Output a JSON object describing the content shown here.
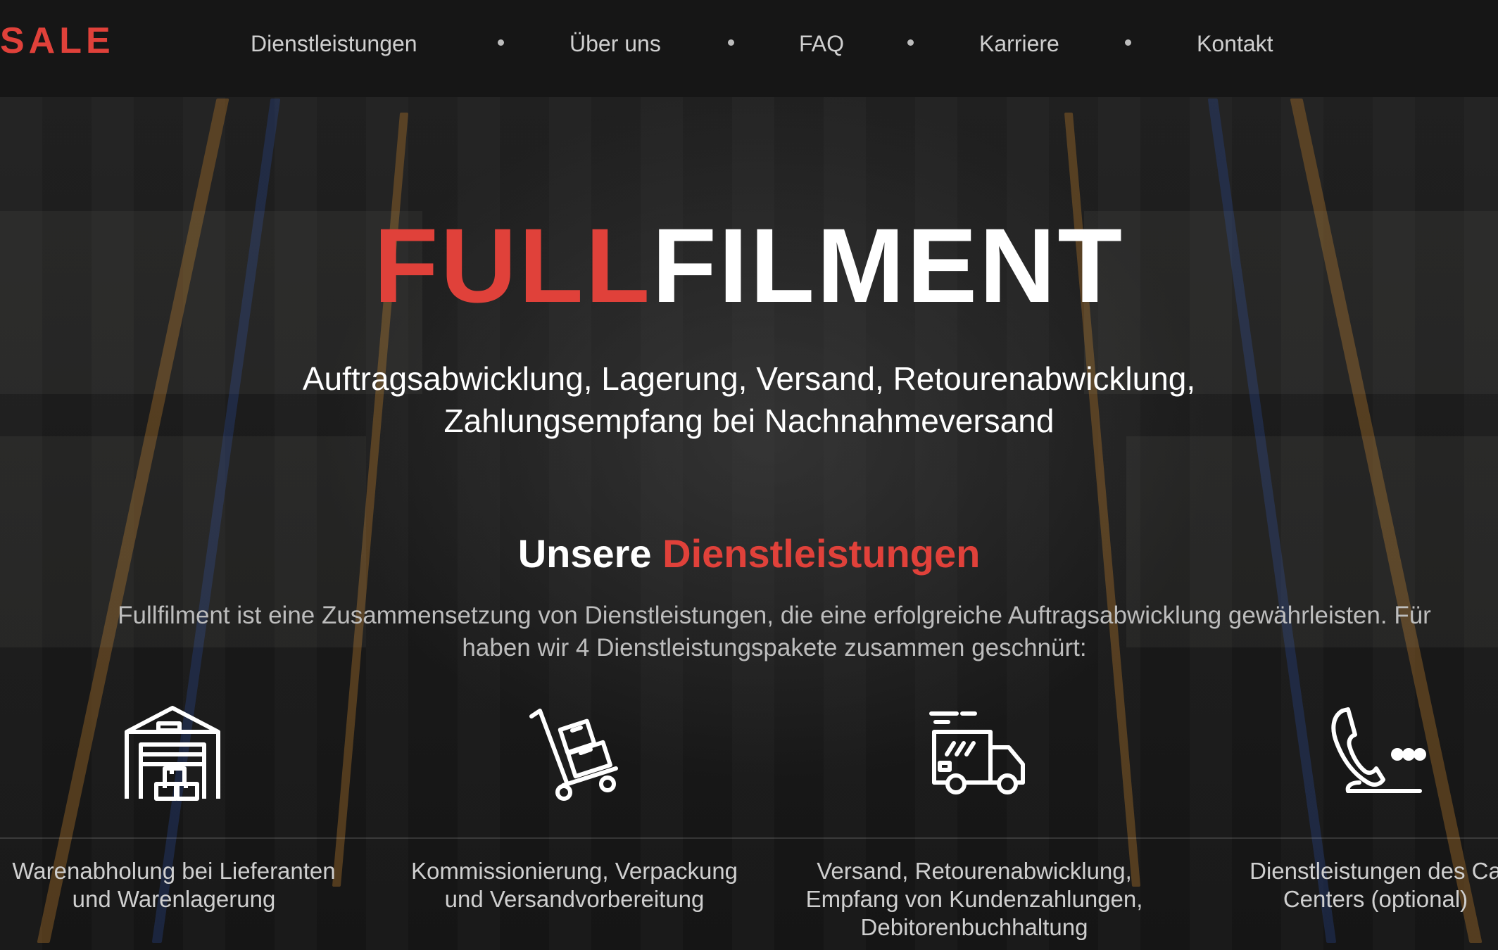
{
  "brand": {
    "logo_text": "SALE",
    "accent_color": "#e0413a"
  },
  "nav": {
    "items": [
      {
        "label": "Dienstleistungen"
      },
      {
        "label": "Über uns"
      },
      {
        "label": "FAQ"
      },
      {
        "label": "Karriere"
      },
      {
        "label": "Kontakt"
      }
    ]
  },
  "hero": {
    "title_red": "FULL",
    "title_white": "FILMENT",
    "subtitle_line1": "Auftragsabwicklung, Lagerung, Versand, Retourenabwicklung,",
    "subtitle_line2": "Zahlungsempfang bei Nachnahmeversand"
  },
  "services": {
    "title_white": "Unsere ",
    "title_red": "Dienstleistungen",
    "desc_line1": "Fullfilment ist eine Zusammensetzung von Dienstleistungen, die eine erfolgreiche Auftragsabwicklung gewährleisten. Für",
    "desc_line2": "haben wir 4 Dienstleistungspakete zusammen geschnürt:",
    "items": [
      {
        "icon": "warehouse-icon",
        "line1": "Warenabholung bei Lieferanten",
        "line2": "und Warenlagerung"
      },
      {
        "icon": "hand-truck-icon",
        "line1": "Kommissionierung, Verpackung",
        "line2": "und Versandvorbereitung"
      },
      {
        "icon": "delivery-truck-icon",
        "line1": "Versand, Retourenabwicklung,",
        "line2": "Empfang von Kundenzahlungen,",
        "line3": "Debitorenbuchhaltung"
      },
      {
        "icon": "phone-call-icon",
        "line1": "Dienstleistungen des Ca",
        "line2": "Centers (optional)"
      }
    ]
  }
}
